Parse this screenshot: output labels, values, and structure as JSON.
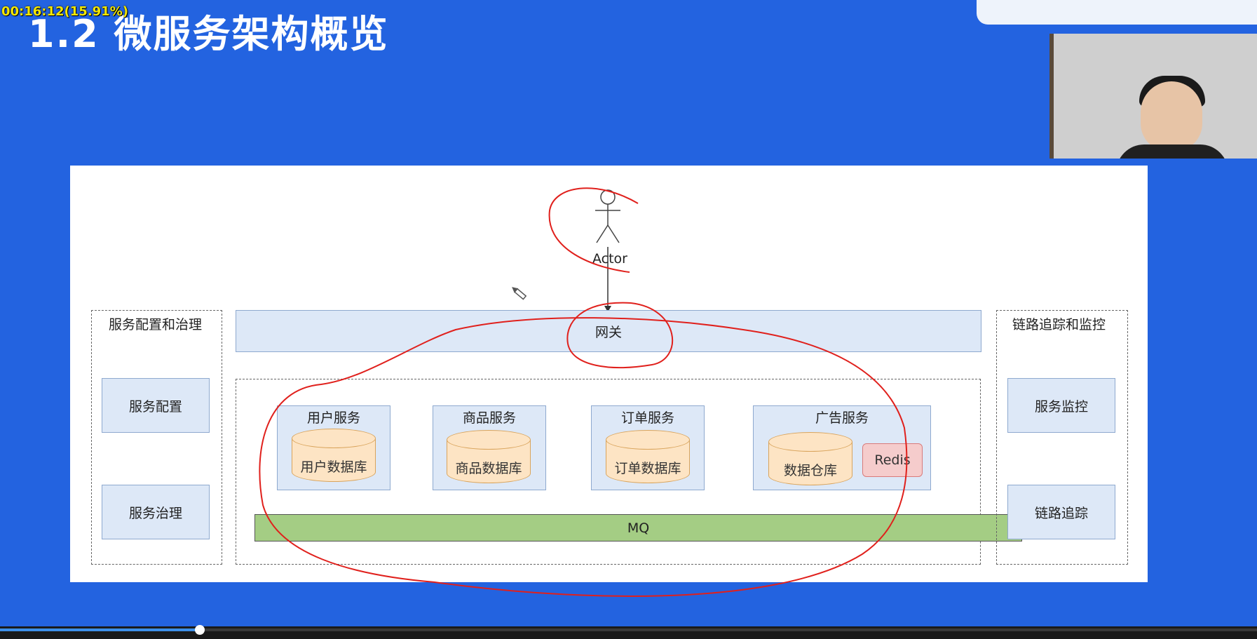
{
  "video": {
    "timecode": "00:16:12(15.91%)",
    "progress_fraction": 0.1591
  },
  "slide": {
    "title": "1.2 微服务架构概览"
  },
  "diagram": {
    "actor_label": "Actor",
    "gateway": "网关",
    "left_group": {
      "title": "服务配置和治理",
      "items": [
        "服务配置",
        "服务治理"
      ]
    },
    "right_group": {
      "title": "链路追踪和监控",
      "items": [
        "服务监控",
        "链路追踪"
      ]
    },
    "services": [
      {
        "name": "用户服务",
        "db": "用户数据库"
      },
      {
        "name": "商品服务",
        "db": "商品数据库"
      },
      {
        "name": "订单服务",
        "db": "订单数据库"
      },
      {
        "name": "广告服务",
        "db": "数据仓库",
        "cache": "Redis"
      }
    ],
    "bus": "MQ"
  },
  "colors": {
    "background": "#2363e0",
    "box_fill": "#dde8f7",
    "db_fill": "#fde4c4",
    "redis_fill": "#f5cccc",
    "mq_fill": "#a4cd84",
    "annotation": "#e0201c"
  },
  "icons": [
    "pen-cursor-icon",
    "actor-icon"
  ]
}
